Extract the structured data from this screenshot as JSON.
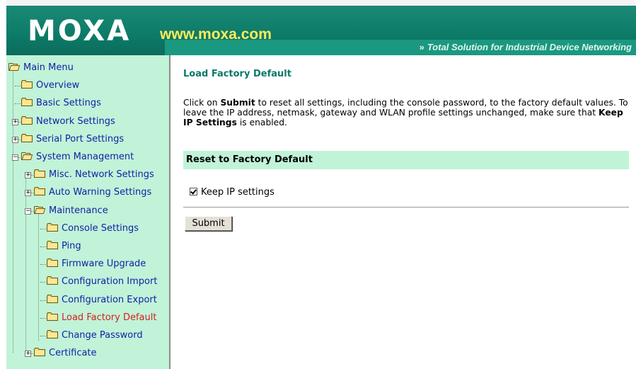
{
  "header": {
    "logo_text": "MOXA",
    "logo_url": "www.moxa.com",
    "tagline": "Total Solution for Industrial Device Networking",
    "tagline_arrows": "»",
    "colors": {
      "header_bg": "#0d7c69",
      "url_color": "#ffec5a"
    }
  },
  "sidebar": {
    "background": "#c1f3d8",
    "items": [
      {
        "label": "Main Menu"
      },
      {
        "label": "Overview"
      },
      {
        "label": "Basic Settings"
      },
      {
        "label": "Network Settings"
      },
      {
        "label": "Serial Port Settings"
      },
      {
        "label": "System Management"
      },
      {
        "label": "Misc. Network Settings"
      },
      {
        "label": "Auto Warning Settings"
      },
      {
        "label": "Maintenance"
      },
      {
        "label": "Console Settings"
      },
      {
        "label": "Ping"
      },
      {
        "label": "Firmware Upgrade"
      },
      {
        "label": "Configuration Import"
      },
      {
        "label": "Configuration Export"
      },
      {
        "label": "Load Factory Default"
      },
      {
        "label": "Change Password"
      },
      {
        "label": "Certificate"
      }
    ]
  },
  "main": {
    "title": "Load Factory Default",
    "description": {
      "part1": "Click on ",
      "submit_word": "Submit",
      "part2": " to reset all settings, including the console password, to the factory default values. To leave the IP address, netmask, gateway and WLAN profile settings unchanged, make sure that ",
      "keep_ip_phrase": "Keep IP Settings",
      "part3": " is enabled."
    },
    "section_title": "Reset to Factory Default",
    "keep_ip_label": "Keep IP settings",
    "keep_ip_checked": true,
    "submit_label": "Submit"
  }
}
